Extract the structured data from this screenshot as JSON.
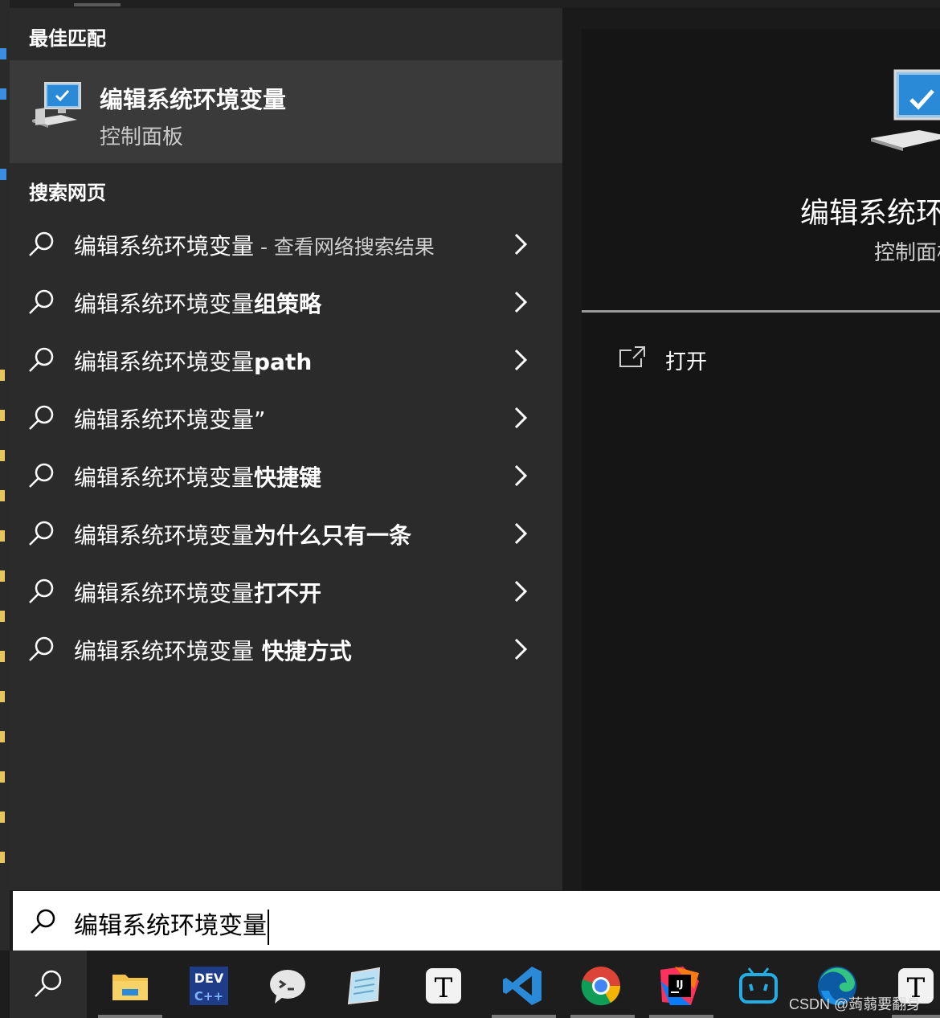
{
  "best_match": {
    "section_title": "最佳匹配",
    "title": "编辑系统环境变量",
    "subtitle": "控制面板"
  },
  "web_search": {
    "section_title": "搜索网页",
    "results": [
      {
        "query": "编辑系统环境变量",
        "suffix": "",
        "hint": " - 查看网络搜索结果"
      },
      {
        "query": "编辑系统环境变量",
        "suffix": "组策略",
        "hint": ""
      },
      {
        "query": "编辑系统环境变量",
        "suffix": "path",
        "hint": ""
      },
      {
        "query": "编辑系统环境变量”",
        "suffix": "",
        "hint": ""
      },
      {
        "query": "编辑系统环境变量",
        "suffix": "快捷键",
        "hint": ""
      },
      {
        "query": "编辑系统环境变量",
        "suffix": "为什么只有一条",
        "hint": ""
      },
      {
        "query": "编辑系统环境变量",
        "suffix": "打不开",
        "hint": ""
      },
      {
        "query": "编辑系统环境变量",
        "suffix": " 快捷方式",
        "hint": ""
      }
    ]
  },
  "preview": {
    "title": "编辑系统环",
    "subtitle": "控制面板",
    "open_label": "打开"
  },
  "search_box": {
    "value": "编辑系统环境变量"
  },
  "taskbar": {
    "apps": [
      "file-explorer",
      "dev-cpp",
      "wechat",
      "notepad",
      "typora",
      "vscode",
      "chrome",
      "intellij-idea",
      "bilibili",
      "edge",
      "typora"
    ]
  },
  "watermark": "CSDN @蒟蒻要翻身"
}
